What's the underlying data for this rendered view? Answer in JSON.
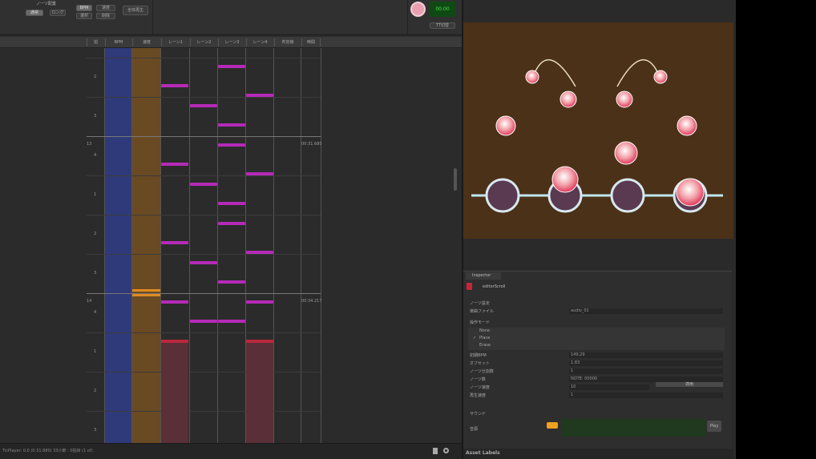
{
  "toolbar": {
    "mode_label": "ノーツ配置",
    "buttons": [
      "通常",
      "ロング",
      "BPM",
      "速度",
      "選択",
      "削除",
      "全体再生"
    ],
    "timer": "00:00",
    "fix_button": "TT切替"
  },
  "grid": {
    "headers": [
      "拍",
      "BPM",
      "速度",
      "レーン1",
      "レーン2",
      "レーン3",
      "レーン4",
      "判定線",
      "時間"
    ],
    "measures": [
      {
        "label": "13",
        "time": "00:31.680"
      },
      {
        "label": "14",
        "time": "00:34.217"
      }
    ],
    "beat_labels": [
      "2",
      "3",
      "4",
      "1",
      "2",
      "3",
      "4",
      "1",
      "2",
      "3",
      "4"
    ],
    "notes": [
      {
        "lane": 0,
        "beat": 1.0
      },
      {
        "lane": 0,
        "beat": 3.0
      },
      {
        "lane": 0,
        "beat": 5.0
      },
      {
        "lane": 0,
        "beat": 6.5
      },
      {
        "lane": 1,
        "beat": 1.5
      },
      {
        "lane": 1,
        "beat": 3.5
      },
      {
        "lane": 1,
        "beat": 5.5
      },
      {
        "lane": 1,
        "beat": 7.0
      },
      {
        "lane": 2,
        "beat": 0.5
      },
      {
        "lane": 2,
        "beat": 2.0
      },
      {
        "lane": 2,
        "beat": 2.5
      },
      {
        "lane": 2,
        "beat": 4.0
      },
      {
        "lane": 2,
        "beat": 4.5
      },
      {
        "lane": 2,
        "beat": 6.0
      },
      {
        "lane": 2,
        "beat": 7.0
      },
      {
        "lane": 3,
        "beat": 1.25
      },
      {
        "lane": 3,
        "beat": 3.25
      },
      {
        "lane": 3,
        "beat": 5.25
      },
      {
        "lane": 3,
        "beat": 6.5
      }
    ],
    "long_notes": [
      {
        "lane": 0,
        "start": 7.5
      },
      {
        "lane": 3,
        "start": 7.5
      }
    ],
    "colors": {
      "note": "#b52ab8",
      "long": "#b8283a",
      "bpm": "#2e3a7a",
      "speed": "#6a4a22"
    }
  },
  "status": {
    "text": "TicPlayer: 0.0 (0:31.680) 33小節 : 0拍目 (1 of)"
  },
  "inspector": {
    "tab": "Inspector",
    "object_name": "editorScroll",
    "rows": [
      {
        "label": "ノーツ設定",
        "value": ""
      },
      {
        "label": "楽曲ファイル",
        "value": "audio_01"
      }
    ],
    "mode_label": "操作モード",
    "mode_options": [
      {
        "label": "None",
        "checked": false
      },
      {
        "label": "Place",
        "checked": true
      },
      {
        "label": "Erase",
        "checked": false
      }
    ],
    "rows2": [
      {
        "label": "初期BPM",
        "value": "149.29"
      },
      {
        "label": "オフセット",
        "value": "1.83"
      },
      {
        "label": "ノーツ分割数",
        "value": "1"
      },
      {
        "label": "ノーツ数",
        "value": "NOTE: 00000"
      },
      {
        "label": "ノーツ速度",
        "value": "10"
      },
      {
        "label": "再生速度",
        "value": "1"
      }
    ],
    "apply_button": "適用",
    "section2": "サウンド",
    "sound_label": "音源",
    "play_button": "Play"
  },
  "asset_labels": "Asset Labels"
}
